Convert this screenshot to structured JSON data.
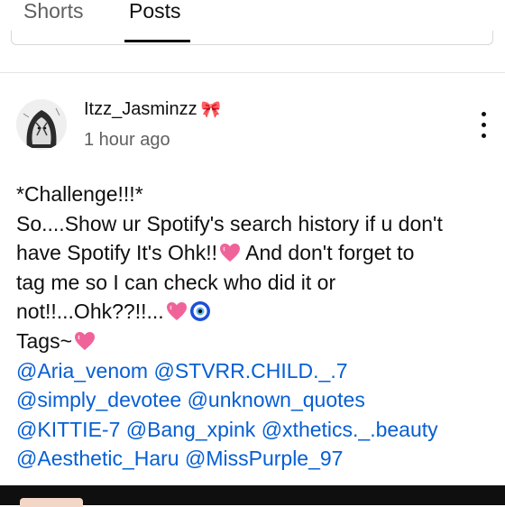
{
  "tabs": [
    {
      "label": "Shorts",
      "active": false
    },
    {
      "label": "Posts",
      "active": true
    }
  ],
  "post": {
    "author": "Itzz_Jasminzz",
    "author_decoration": "🎀",
    "timestamp": "1 hour ago",
    "menu_icon": "more-vertical-icon",
    "lines": [
      "*Challenge!!!*",
      "So....Show ur Spotify's search history if u don't",
      "have Spotify It's Ohk!!",
      " And don't forget to",
      "tag me so I can check who did it or",
      "not!!...Ohk??!!...",
      "Tags~"
    ],
    "mentions": [
      "@Aria_venom",
      "@STVRR.CHILD._.7",
      "@simply_devotee",
      "@unknown_quotes",
      "@KITTIE-7",
      "@Bang_xpink",
      "@xthetics._.beauty",
      "@Aesthetic_Haru",
      "@MissPurple_97"
    ]
  },
  "colors": {
    "link": "#065fd4",
    "heart": "#f0639a",
    "text": "#0f0f0f",
    "secondary": "#606060"
  }
}
